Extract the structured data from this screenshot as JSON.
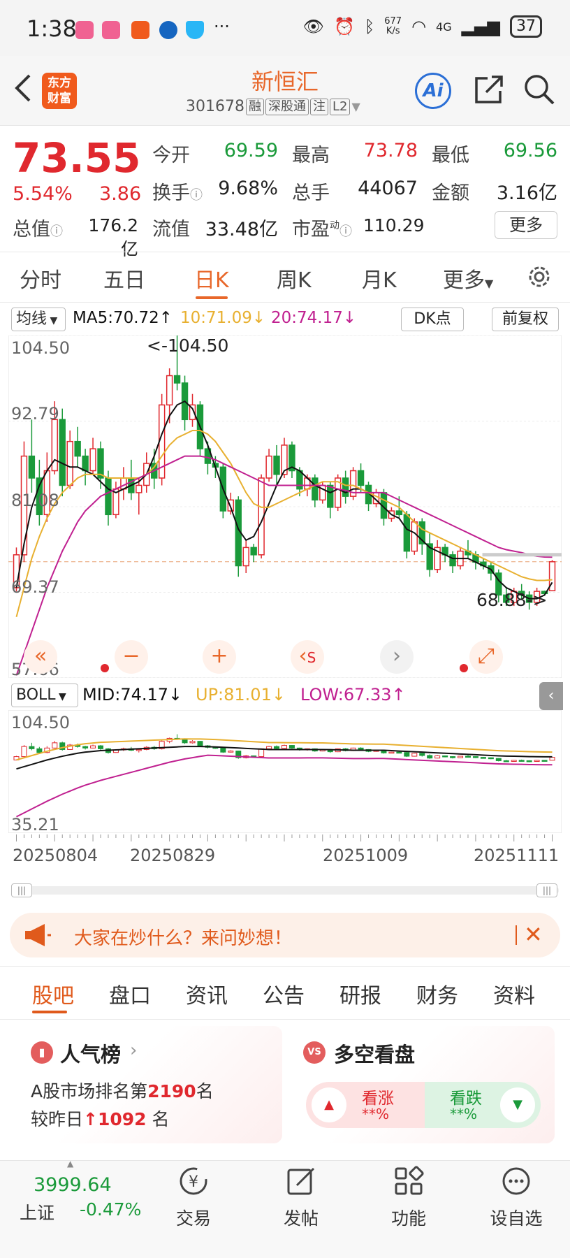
{
  "status_bar": {
    "time": "1:38",
    "net_speed_top": "677",
    "net_speed_bottom": "K/s",
    "network": "4G",
    "battery": "37"
  },
  "header": {
    "logo_line1": "东方",
    "logo_line2": "财富",
    "stock_name": "新恒汇",
    "stock_code": "301678",
    "tags": [
      "融",
      "深股通",
      "注",
      "L2"
    ],
    "ai_label": "Ai"
  },
  "quote": {
    "price": "73.55",
    "change_pct": "5.54%",
    "change_amt": "3.86",
    "open_label": "今开",
    "open": "69.59",
    "high_label": "最高",
    "high": "73.78",
    "low_label": "最低",
    "low": "69.56",
    "turnover_label": "换手",
    "turnover": "9.68%",
    "volume_label": "总手",
    "volume": "44067",
    "amount_label": "金额",
    "amount": "3.16亿",
    "mktcap_label": "总值",
    "mktcap": "176.2亿",
    "float_label": "流值",
    "float": "33.48亿",
    "pe_label": "市盈",
    "pe_sup": "动",
    "pe": "110.29",
    "more_label": "更多"
  },
  "period_tabs": [
    "分时",
    "五日",
    "日K",
    "周K",
    "月K",
    "更多"
  ],
  "active_period": "日K",
  "chart_header": {
    "ma_button": "均线",
    "ma5": "MA5:70.72↑",
    "ma10": "10:71.09↓",
    "ma20": "20:74.17↓",
    "dk_button": "DK点",
    "fq_button": "前复权"
  },
  "colors": {
    "up": "#e0282e",
    "down": "#1a9a3a",
    "ma5": "#111111",
    "ma10": "#e8b030",
    "ma20": "#c02090",
    "accent": "#e8672a"
  },
  "chart_data": [
    {
      "type": "candlestick",
      "title": "",
      "y_ticks": [
        "104.50",
        "92.79",
        "81.08",
        "69.37",
        "57.66"
      ],
      "ylim": [
        57.66,
        104.5
      ],
      "annotations": [
        "<-104.50",
        "68.88->"
      ],
      "current_price_line": 73.55,
      "candles_ohlc": [
        [
          70.0,
          75.5,
          69.5,
          74.5
        ],
        [
          74.5,
          90.0,
          73.5,
          88.0
        ],
        [
          88.0,
          93.0,
          83.0,
          85.0
        ],
        [
          85.0,
          87.5,
          78.5,
          80.0
        ],
        [
          80.0,
          88.5,
          79.0,
          86.0
        ],
        [
          86.0,
          95.5,
          85.5,
          93.0
        ],
        [
          93.0,
          94.5,
          82.5,
          84.0
        ],
        [
          84.0,
          91.5,
          83.5,
          90.0
        ],
        [
          90.0,
          92.0,
          86.5,
          88.0
        ],
        [
          88.0,
          89.0,
          84.0,
          86.0
        ],
        [
          86.0,
          90.5,
          85.5,
          89.0
        ],
        [
          89.0,
          90.0,
          83.5,
          85.0
        ],
        [
          85.0,
          86.0,
          78.5,
          80.0
        ],
        [
          80.0,
          84.5,
          79.5,
          83.5
        ],
        [
          83.5,
          86.5,
          82.0,
          85.0
        ],
        [
          85.0,
          87.5,
          82.0,
          83.0
        ],
        [
          83.0,
          85.0,
          80.0,
          84.0
        ],
        [
          84.0,
          88.5,
          83.0,
          87.0
        ],
        [
          87.0,
          89.0,
          83.5,
          85.0
        ],
        [
          85.0,
          96.5,
          84.0,
          95.0
        ],
        [
          95.0,
          100.0,
          92.5,
          99.0
        ],
        [
          99.0,
          104.5,
          97.0,
          98.0
        ],
        [
          98.0,
          99.0,
          91.5,
          93.0
        ],
        [
          93.0,
          96.5,
          92.0,
          95.0
        ],
        [
          95.0,
          95.5,
          88.0,
          89.0
        ],
        [
          89.0,
          90.0,
          85.5,
          87.0
        ],
        [
          87.0,
          88.0,
          85.0,
          86.5
        ],
        [
          86.5,
          87.0,
          79.5,
          80.5
        ],
        [
          80.5,
          83.0,
          80.0,
          82.0
        ],
        [
          82.0,
          82.5,
          71.5,
          73.0
        ],
        [
          73.0,
          76.5,
          72.0,
          75.5
        ],
        [
          75.5,
          76.0,
          73.5,
          74.5
        ],
        [
          74.5,
          85.5,
          74.0,
          85.0
        ],
        [
          85.0,
          89.0,
          84.5,
          88.0
        ],
        [
          88.0,
          89.5,
          84.0,
          85.5
        ],
        [
          85.5,
          90.5,
          85.0,
          89.5
        ],
        [
          89.5,
          90.0,
          85.0,
          86.0
        ],
        [
          86.0,
          86.5,
          82.5,
          83.5
        ],
        [
          83.5,
          85.5,
          82.5,
          85.0
        ],
        [
          85.0,
          85.5,
          81.0,
          82.0
        ],
        [
          82.0,
          84.5,
          81.5,
          84.0
        ],
        [
          84.0,
          84.5,
          79.5,
          81.0
        ],
        [
          81.0,
          85.5,
          80.5,
          85.0
        ],
        [
          85.0,
          86.0,
          81.5,
          82.5
        ],
        [
          82.5,
          86.5,
          82.0,
          86.0
        ],
        [
          86.0,
          87.0,
          83.0,
          84.0
        ],
        [
          84.0,
          84.5,
          80.5,
          81.5
        ],
        [
          81.5,
          83.5,
          81.0,
          83.0
        ],
        [
          83.0,
          83.5,
          78.5,
          79.5
        ],
        [
          79.5,
          81.0,
          79.0,
          80.5
        ],
        [
          80.5,
          82.5,
          79.5,
          80.0
        ],
        [
          80.0,
          80.5,
          74.0,
          75.0
        ],
        [
          75.0,
          79.5,
          74.5,
          79.0
        ],
        [
          79.0,
          79.5,
          74.5,
          76.0
        ],
        [
          76.0,
          77.5,
          71.5,
          72.5
        ],
        [
          72.5,
          76.5,
          72.0,
          75.5
        ],
        [
          75.5,
          76.0,
          73.5,
          74.5
        ],
        [
          74.5,
          75.0,
          72.0,
          73.0
        ],
        [
          73.0,
          75.5,
          72.5,
          75.0
        ],
        [
          75.0,
          76.5,
          74.0,
          74.5
        ],
        [
          74.5,
          75.0,
          72.5,
          73.5
        ],
        [
          73.5,
          74.0,
          72.5,
          73.0
        ],
        [
          73.0,
          73.5,
          71.0,
          72.0
        ],
        [
          72.0,
          72.5,
          68.0,
          69.0
        ],
        [
          69.0,
          70.0,
          67.5,
          68.0
        ],
        [
          68.0,
          70.0,
          67.5,
          69.5
        ],
        [
          69.5,
          70.5,
          68.5,
          69.0
        ],
        [
          69.0,
          69.5,
          67.0,
          68.0
        ],
        [
          68.0,
          70.0,
          67.5,
          69.5
        ],
        [
          69.5,
          69.6,
          68.88,
          69.2
        ],
        [
          69.59,
          73.78,
          69.56,
          73.55
        ]
      ],
      "series": [
        {
          "name": "MA5",
          "color": "#111111",
          "values": [
            70.0,
            76.0,
            81.0,
            84.0,
            86.0,
            87.5,
            87.0,
            86.5,
            86.5,
            86.0,
            85.5,
            84.5,
            83.5,
            83.0,
            83.5,
            84.0,
            84.5,
            85.5,
            88.0,
            91.0,
            93.5,
            95.0,
            95.5,
            94.5,
            92.0,
            89.5,
            86.5,
            83.5,
            81.0,
            78.0,
            76.5,
            77.0,
            79.0,
            81.5,
            84.0,
            86.0,
            86.5,
            86.0,
            85.0,
            84.0,
            83.5,
            83.0,
            83.5,
            83.0,
            83.5,
            83.5,
            83.0,
            82.0,
            81.0,
            80.0,
            79.5,
            78.0,
            77.5,
            76.5,
            75.5,
            75.0,
            74.5,
            74.0,
            74.0,
            74.0,
            73.5,
            73.0,
            72.5,
            71.0,
            70.0,
            69.5,
            69.0,
            68.5,
            68.5,
            69.0,
            70.72
          ]
        },
        {
          "name": "MA10",
          "color": "#e8b030",
          "values": [
            66.0,
            70.0,
            74.0,
            77.0,
            79.5,
            81.5,
            83.0,
            84.0,
            85.0,
            85.5,
            85.5,
            85.5,
            85.0,
            85.0,
            85.0,
            85.0,
            85.0,
            85.5,
            86.5,
            88.0,
            89.5,
            90.5,
            91.0,
            91.5,
            91.5,
            91.0,
            90.0,
            88.5,
            87.0,
            85.0,
            83.0,
            81.5,
            81.0,
            81.0,
            81.5,
            82.0,
            82.5,
            83.0,
            83.5,
            84.0,
            84.5,
            84.5,
            84.5,
            84.0,
            84.0,
            83.5,
            83.0,
            82.5,
            82.0,
            81.5,
            81.0,
            80.0,
            79.0,
            78.0,
            77.5,
            77.0,
            76.5,
            76.0,
            75.5,
            75.0,
            74.5,
            74.0,
            73.5,
            73.0,
            72.5,
            72.0,
            71.5,
            71.2,
            71.0,
            71.0,
            71.09
          ]
        },
        {
          "name": "MA20",
          "color": "#c02090",
          "values": [
            58.0,
            61.0,
            64.0,
            67.0,
            70.0,
            72.5,
            75.0,
            77.0,
            79.0,
            80.5,
            81.5,
            82.5,
            83.0,
            83.5,
            84.0,
            84.5,
            85.0,
            85.5,
            86.0,
            86.5,
            87.0,
            87.5,
            88.0,
            88.0,
            88.0,
            87.8,
            87.5,
            87.0,
            86.5,
            86.0,
            85.5,
            85.0,
            84.5,
            84.0,
            84.0,
            84.0,
            84.0,
            84.0,
            84.0,
            84.0,
            84.0,
            83.8,
            83.5,
            83.3,
            83.0,
            83.0,
            83.0,
            83.0,
            83.0,
            82.5,
            82.0,
            81.5,
            81.0,
            80.5,
            80.0,
            79.5,
            79.0,
            78.5,
            78.0,
            77.5,
            77.0,
            76.5,
            76.0,
            75.5,
            75.2,
            75.0,
            74.8,
            74.5,
            74.3,
            74.2,
            74.17
          ]
        }
      ]
    },
    {
      "type": "line",
      "title": "",
      "indicator": "BOLL",
      "legend": [
        "MID:74.17↓",
        "UP:81.01↓",
        "LOW:67.33↑"
      ],
      "y_ticks": [
        "104.50",
        "35.21"
      ],
      "ylim": [
        35.21,
        104.5
      ],
      "x_ticks": [
        "20250804",
        "20250829",
        "20251009",
        "20251111"
      ]
    }
  ],
  "boll_header": {
    "button": "BOLL",
    "mid": "MID:74.17↓",
    "up": "UP:81.01↓",
    "low": "LOW:67.33↑"
  },
  "banner": {
    "text": "大家在炒什么？来问妙想！"
  },
  "bottom_tabs": [
    "股吧",
    "盘口",
    "资讯",
    "公告",
    "研报",
    "财务",
    "资料"
  ],
  "active_bottom_tab": "股吧",
  "popularity_card": {
    "title": "人气榜",
    "line1_prefix": "A股市场排名第",
    "rank": "2190",
    "line1_suffix": "名",
    "line2_prefix": "较昨日",
    "change": "1092",
    "line2_suffix": "名"
  },
  "bullbear_card": {
    "title": "多空看盘",
    "bull_label": "看涨",
    "bull_value": "**%",
    "bear_label": "看跌",
    "bear_value": "**%"
  },
  "bottom_nav": {
    "index_value": "3999.64",
    "index_name": "上证",
    "index_change": "-0.47%",
    "items": [
      "交易",
      "发帖",
      "功能",
      "设自选"
    ]
  }
}
